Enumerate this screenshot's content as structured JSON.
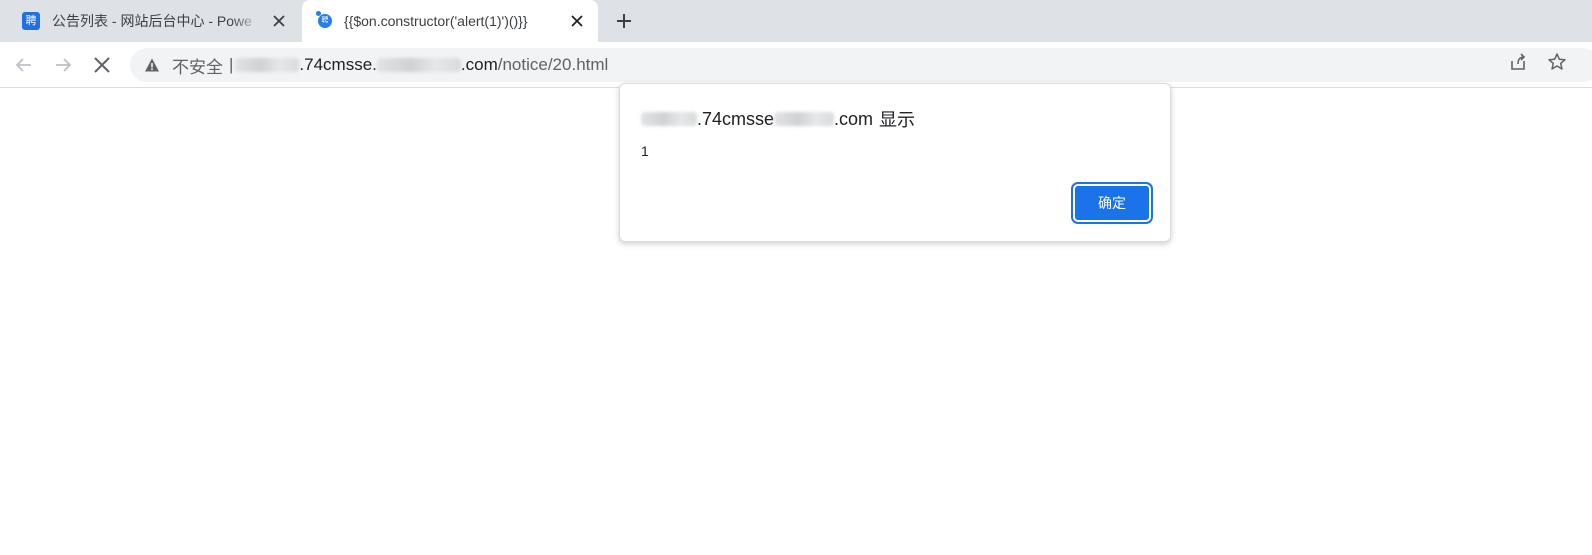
{
  "tabs": [
    {
      "favicon_text": "聘",
      "title": "公告列表 - 网站后台中心 - Powe",
      "active": false
    },
    {
      "favicon_text": "聘",
      "title": "{{$on.constructor('alert(1)')()}}",
      "active": true
    }
  ],
  "omnibox": {
    "security_label": "不安全",
    "separator": "|",
    "host_part_1": ".74cmsse.",
    "host_part_2": ".com",
    "path": "/notice/20.html"
  },
  "dialog": {
    "origin_part_1": ".74cmsse",
    "origin_part_2": ".com",
    "title_suffix": "显示",
    "message": "1",
    "ok_label": "确定"
  },
  "colors": {
    "accent": "#1a73e8",
    "tabstrip": "#dee1e6",
    "omnibox_bg": "#f1f3f4"
  },
  "icons": [
    "back-arrow-icon",
    "forward-arrow-icon",
    "stop-loading-icon",
    "not-secure-warning-icon",
    "share-icon",
    "bookmark-star-icon",
    "close-icon",
    "plus-icon"
  ]
}
